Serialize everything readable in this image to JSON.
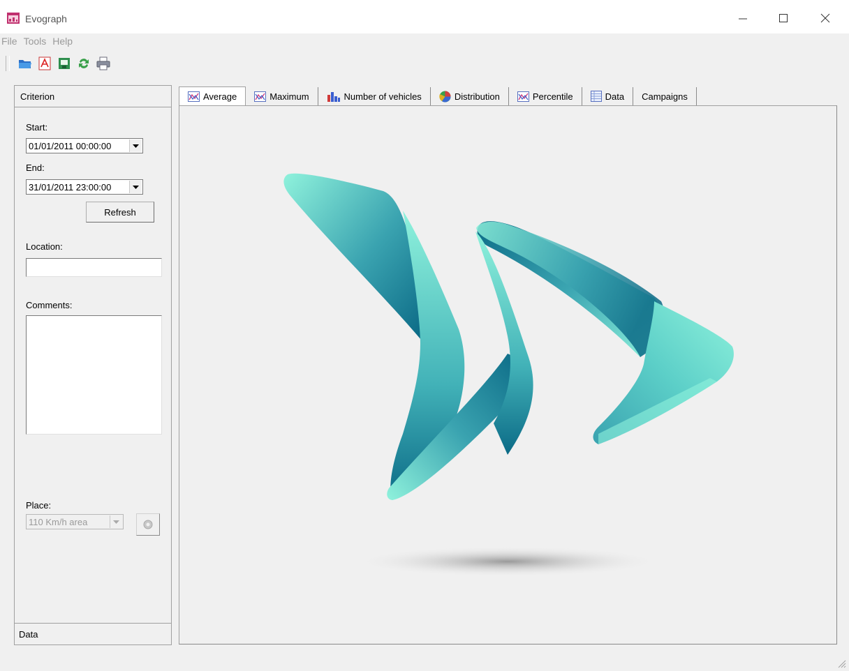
{
  "window": {
    "title": "Evograph"
  },
  "menu": [
    "File",
    "Tools",
    "Help"
  ],
  "toolbar": [
    "open-folder-icon",
    "pdf-icon",
    "export-icon",
    "refresh-icon",
    "print-icon"
  ],
  "left_panel": {
    "header": "Criterion",
    "start_label": "Start:",
    "start_value": "01/01/2011 00:00:00",
    "end_label": "End:",
    "end_value": "31/01/2011 23:00:00",
    "refresh_label": "Refresh",
    "location_label": "Location:",
    "location_value": "",
    "comments_label": "Comments:",
    "comments_value": "",
    "place_label": "Place:",
    "place_value": "110  Km/h area",
    "footer": "Data"
  },
  "tabs": [
    {
      "label": "Average",
      "icon": "line-chart-icon"
    },
    {
      "label": "Maximum",
      "icon": "line-chart-icon"
    },
    {
      "label": "Number of vehicles",
      "icon": "bar-chart-icon"
    },
    {
      "label": "Distribution",
      "icon": "pie-chart-icon"
    },
    {
      "label": "Percentile",
      "icon": "line-chart-icon"
    },
    {
      "label": "Data",
      "icon": "table-icon"
    },
    {
      "label": "Campaigns",
      "icon": ""
    }
  ],
  "colors": {
    "logo_light": "#8ff2dc",
    "logo_mid": "#40aeb6",
    "logo_dark": "#0b6a86",
    "app_icon": "#c0306e"
  }
}
